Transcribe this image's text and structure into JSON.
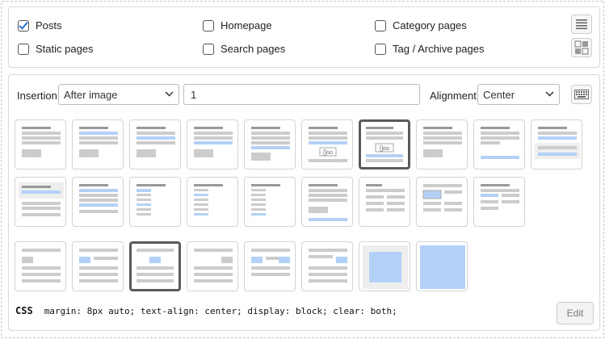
{
  "page_types": [
    {
      "label": "Posts",
      "checked": true
    },
    {
      "label": "Homepage",
      "checked": false
    },
    {
      "label": "Category pages",
      "checked": false
    },
    {
      "label": "Static pages",
      "checked": false
    },
    {
      "label": "Search pages",
      "checked": false
    },
    {
      "label": "Tag / Archive pages",
      "checked": false
    }
  ],
  "toolbar": {
    "list_icon": "list-view-icon",
    "grid_icon": "grid-view-icon",
    "keyboard_icon": "keyboard-icon"
  },
  "insertion": {
    "label": "Insertion",
    "selected": "After image",
    "position_value": "1"
  },
  "alignment": {
    "label": "Alignment",
    "selected": "Center"
  },
  "css": {
    "label": "CSS",
    "code": "margin: 8px auto; text-align: center; display: block; clear: both;"
  },
  "edit_button": {
    "label": "Edit"
  },
  "layout_thumbnails": {
    "count": 26,
    "selected_rows": [
      {
        "row": 1,
        "index": 7
      },
      {
        "row": 3,
        "index": 3
      }
    ]
  },
  "colors": {
    "accent_blue": "#b3d1f7",
    "gray_bar": "#c9c9c9",
    "selected_border": "#5a5a5a",
    "check": "#2d6fd1"
  }
}
